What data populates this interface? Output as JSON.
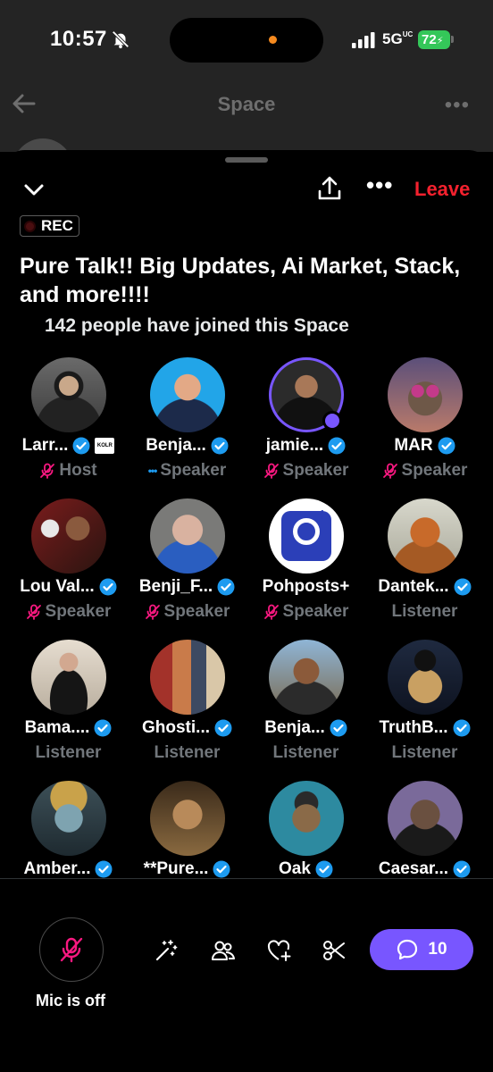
{
  "status_bar": {
    "time": "10:57",
    "network": "5G",
    "network_suffix": "UC",
    "battery": "72"
  },
  "underlying_page": {
    "title": "Space",
    "more": "•••"
  },
  "sheet": {
    "leave_label": "Leave",
    "more_label": "•••",
    "rec_label": "REC",
    "title": "Pure Talk!! Big Updates, Ai Market, Stack, and more!!!!",
    "joined_text": "142 people have joined this Space"
  },
  "participants": [
    {
      "name": "Larr...",
      "role": "Host",
      "verified": true,
      "mic": "off"
    },
    {
      "name": "Benja...",
      "role": "Speaker",
      "verified": true,
      "mic": "talking"
    },
    {
      "name": "jamie...",
      "role": "Speaker",
      "verified": true,
      "mic": "off"
    },
    {
      "name": "MAR",
      "role": "Speaker",
      "verified": true,
      "mic": "off"
    },
    {
      "name": "Lou Val...",
      "role": "Speaker",
      "verified": true,
      "mic": "off"
    },
    {
      "name": "Benji_F...",
      "role": "Speaker",
      "verified": true,
      "mic": "off"
    },
    {
      "name": "Pohposts+",
      "role": "Speaker",
      "verified": false,
      "mic": "off"
    },
    {
      "name": "Dantek...",
      "role": "Listener",
      "verified": true,
      "mic": "none"
    },
    {
      "name": "Bama....",
      "role": "Listener",
      "verified": true,
      "mic": "none"
    },
    {
      "name": "Ghosti...",
      "role": "Listener",
      "verified": true,
      "mic": "none"
    },
    {
      "name": "Benja...",
      "role": "Listener",
      "verified": true,
      "mic": "none"
    },
    {
      "name": "TruthB...",
      "role": "Listener",
      "verified": true,
      "mic": "none"
    },
    {
      "name": "Amber...",
      "role": "",
      "verified": true,
      "mic": "none"
    },
    {
      "name": "**Pure...",
      "role": "",
      "verified": true,
      "mic": "none"
    },
    {
      "name": "Oak",
      "role": "",
      "verified": true,
      "mic": "none"
    },
    {
      "name": "Caesar...",
      "role": "",
      "verified": true,
      "mic": "none"
    }
  ],
  "controls": {
    "mic_label": "Mic is off",
    "chat_count": "10"
  },
  "colors": {
    "accent": "#7856ff",
    "leave": "#f4212e",
    "verified": "#1d9bf0",
    "mic_off": "#f91880",
    "muted_text": "#71767b"
  }
}
